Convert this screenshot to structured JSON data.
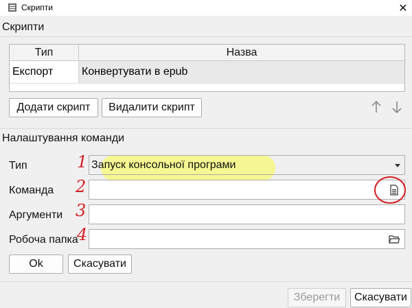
{
  "window": {
    "title": "Скрипти",
    "close_glyph": "✕"
  },
  "scripts_section": {
    "label": "Скрипти",
    "table": {
      "headers": [
        "Тип",
        "Назва"
      ],
      "rows": [
        {
          "type": "Експорт",
          "name": "Конвертувати в epub"
        }
      ]
    },
    "add_button": "Додати скрипт",
    "remove_button": "Видалити скрипт",
    "move_up_icon": "arrow-up-icon",
    "move_down_icon": "arrow-down-icon"
  },
  "command_section": {
    "label": "Налаштування команди",
    "fields": {
      "type": {
        "label": "Тип",
        "value": "Запуск консольної програми"
      },
      "command": {
        "label": "Команда",
        "value": "",
        "icon": "file-icon"
      },
      "arguments": {
        "label": "Аргументи",
        "value": ""
      },
      "workdir": {
        "label": "Робоча папка",
        "value": "",
        "icon": "folder-icon"
      }
    },
    "ok_button": "Ok",
    "cancel_button": "Скасувати"
  },
  "footer": {
    "save_button": "Зберегти",
    "cancel_button": "Скасувати"
  },
  "annotations": {
    "numbers": [
      "1",
      "2",
      "3",
      "4"
    ],
    "color": "#d31f26",
    "highlight_color": "#fcfc46"
  }
}
